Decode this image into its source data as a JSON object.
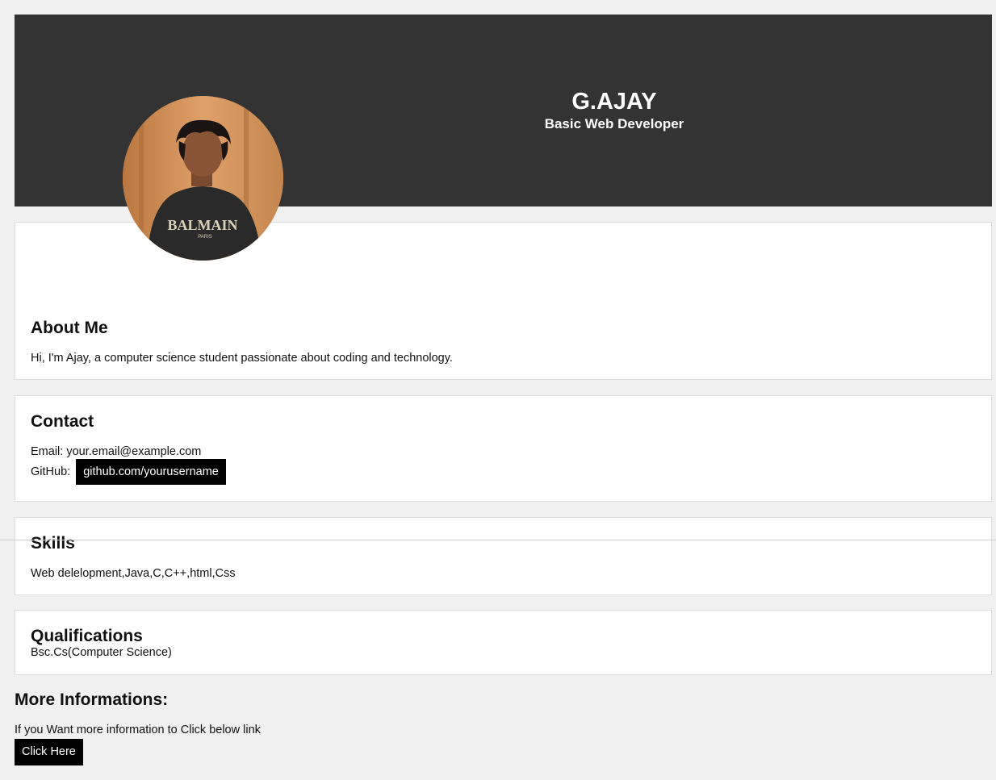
{
  "header": {
    "name": "G.AJAY",
    "role": "Basic Web Developer",
    "background_color": "#333333"
  },
  "avatar": {
    "icon": "profile-photo",
    "shirt_text": "BALMAIN",
    "shirt_subtext": "PARIS"
  },
  "about": {
    "title": "About Me",
    "text": "Hi, I'm Ajay, a computer science student passionate about coding and technology."
  },
  "contact": {
    "title": "Contact",
    "email_label": "Email:",
    "email_value": "your.email@example.com",
    "github_label": "GitHub:",
    "github_link": "github.com/yourusername"
  },
  "skills": {
    "title": "Skills",
    "text": "Web delelopment,Java,C,C++,html,Css"
  },
  "qualifications": {
    "title": "Qualifications",
    "text": "Bsc.Cs(Computer Science)"
  },
  "more": {
    "title": "More Informations:",
    "text": "If you Want more information to Click below link",
    "button_label": "Click Here"
  }
}
